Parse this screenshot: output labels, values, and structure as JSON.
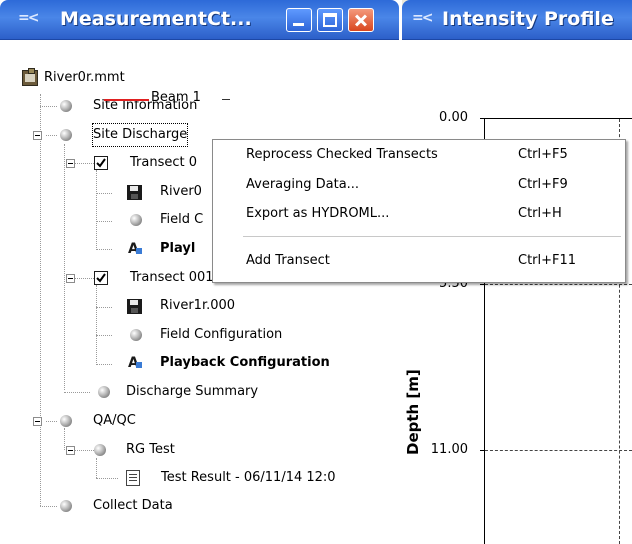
{
  "left_window": {
    "title": "MeasurementCt...",
    "title_icon": "=<"
  },
  "tree": {
    "root": "River0r.mmt",
    "site_information": "Site Information",
    "site_discharge": "Site Discharge",
    "transect_0": "Transect 0",
    "transect_0_file": "River0",
    "transect_0_field": "Field C",
    "transect_0_playback": "Playl",
    "transect_1": "Transect 001",
    "transect_1_file": "River1r.000",
    "transect_1_field": "Field Configuration",
    "transect_1_playback": "Playback Configuration",
    "discharge_summary": "Discharge Summary",
    "qaqc": "QA/QC",
    "rg_test": "RG Test",
    "test_result": "Test Result - 06/11/14 12:0",
    "collect_data": "Collect Data"
  },
  "right_window": {
    "title": "Intensity Profile",
    "title_icon": "=<"
  },
  "plot": {
    "legend": "Beam 1",
    "ylabel": "Depth [m]",
    "yticks": [
      "0.00",
      "5.50",
      "11.00"
    ]
  },
  "context_menu": {
    "items": [
      {
        "label": "Reprocess Checked Transects",
        "shortcut": "Ctrl+F5"
      },
      {
        "label": "Averaging Data...",
        "shortcut": "Ctrl+F9"
      },
      {
        "label": "Export as HYDROML...",
        "shortcut": "Ctrl+H"
      },
      {
        "label": "Add Transect",
        "shortcut": "Ctrl+F11"
      }
    ]
  },
  "colors": {
    "titlebar": "#3a78e0",
    "close_button": "#d9461f",
    "beam1_line": "#e02020"
  }
}
